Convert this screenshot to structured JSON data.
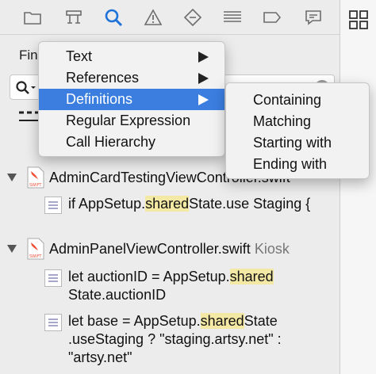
{
  "toolbar": {
    "icons": [
      "folder-icon",
      "hierarchy-icon",
      "search-icon",
      "warning-icon",
      "test-icon",
      "debug-icon",
      "breakpoint-icon",
      "report-icon"
    ],
    "active": "search-icon",
    "accent": "#1f73d8"
  },
  "find": {
    "label": "Fin"
  },
  "menu": {
    "items": [
      {
        "label": "Text",
        "has_submenu": true
      },
      {
        "label": "References",
        "has_submenu": true
      },
      {
        "label": "Definitions",
        "has_submenu": true,
        "selected": true
      },
      {
        "label": "Regular Expression",
        "has_submenu": false
      },
      {
        "label": "Call Hierarchy",
        "has_submenu": false
      }
    ],
    "submenu": [
      "Containing",
      "Matching",
      "Starting with",
      "Ending with"
    ],
    "selection_color": "#3b7ee0"
  },
  "results": {
    "files": [
      {
        "name": "AdminCardTestingViewController.swift",
        "project": "",
        "matches": [
          {
            "before": "if AppSetup.",
            "highlight": "shared",
            "after": "State.use Staging {"
          }
        ]
      },
      {
        "name": "AdminPanelViewController.swift",
        "project": "Kiosk",
        "matches": [
          {
            "before": "let auctionID = AppSetup.",
            "highlight": "shared",
            "after": " State.auctionID"
          },
          {
            "before": "let base = AppSetup.",
            "highlight": "shared",
            "after": "State .useStaging ? \"staging.artsy.net\" : \"artsy.net\""
          }
        ]
      }
    ],
    "highlight_color": "#f4e9a4"
  }
}
